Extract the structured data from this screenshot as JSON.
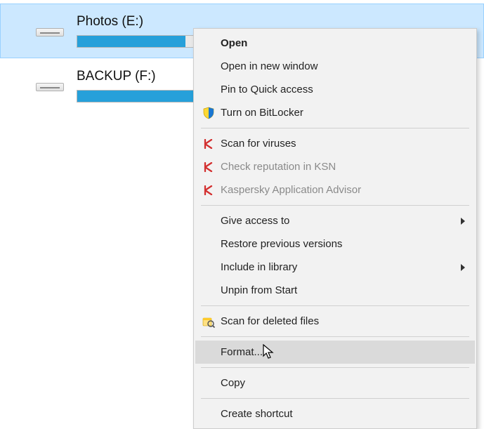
{
  "drives": [
    {
      "label": "Photos (E:)",
      "fill_pct": 36,
      "selected": true
    },
    {
      "label": "BACKUP (F:)",
      "fill_pct": 100,
      "selected": false
    }
  ],
  "context_menu": {
    "items": [
      {
        "label": "Open",
        "bold": true
      },
      {
        "label": "Open in new window"
      },
      {
        "label": "Pin to Quick access"
      },
      {
        "label": "Turn on BitLocker",
        "icon": "shield-icon"
      },
      {
        "sep": true
      },
      {
        "label": "Scan for viruses",
        "icon": "kaspersky-icon"
      },
      {
        "label": "Check reputation in KSN",
        "icon": "kaspersky-icon",
        "disabled": true
      },
      {
        "label": "Kaspersky Application Advisor",
        "icon": "kaspersky-icon",
        "disabled": true
      },
      {
        "sep": true
      },
      {
        "label": "Give access to",
        "submenu": true
      },
      {
        "label": "Restore previous versions"
      },
      {
        "label": "Include in library",
        "submenu": true
      },
      {
        "label": "Unpin from Start"
      },
      {
        "sep": true
      },
      {
        "label": "Scan for deleted files",
        "icon": "magnifier-icon"
      },
      {
        "sep": true
      },
      {
        "label": "Format...",
        "hovered": true
      },
      {
        "sep": true
      },
      {
        "label": "Copy"
      },
      {
        "sep": true
      },
      {
        "label": "Create shortcut"
      }
    ]
  },
  "colors": {
    "selection_bg": "#cce8ff",
    "capacity_fill": "#26a0da",
    "menu_bg": "#f2f2f2",
    "hover_bg": "#dadada"
  }
}
